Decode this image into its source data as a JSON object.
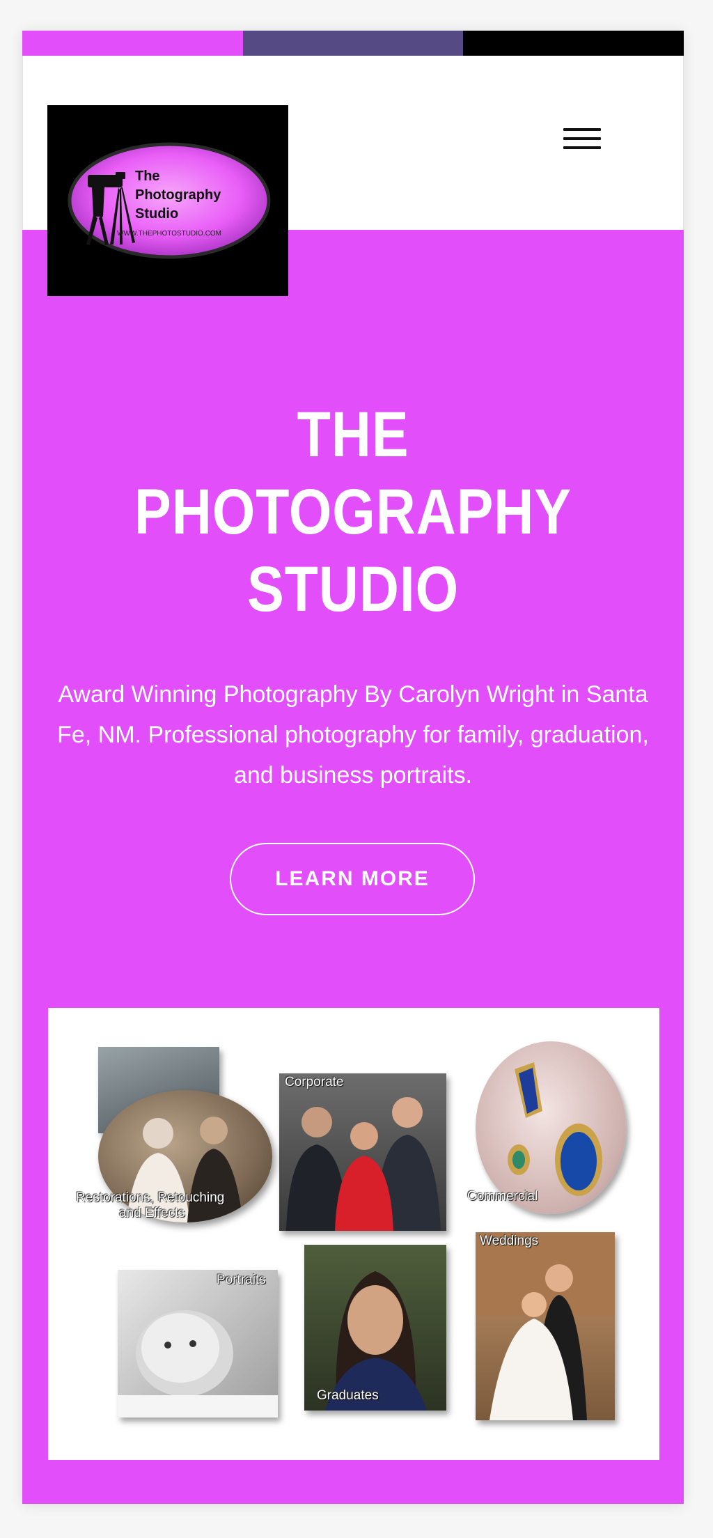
{
  "topbar": {
    "colors": [
      "#e24ffa",
      "#554a84",
      "#000000"
    ]
  },
  "logo": {
    "line1": "The",
    "line2": "Photography",
    "line3": "Studio",
    "url": "WWW.THEPHOTOSTUDIO.COM",
    "ellipse_color": "#e95ef7"
  },
  "header": {
    "menu_icon": "hamburger-menu-icon"
  },
  "hero": {
    "title_line1": "THE",
    "title_line2": "PHOTOGRAPHY",
    "title_line3": "STUDIO",
    "subtitle": "Award Winning Photography By Carolyn Wright in Santa Fe, NM. Professional photography for family, graduation, and business portraits.",
    "button_label": "LEARN MORE",
    "background": "#e24ffa"
  },
  "collage": {
    "restorations": "Restorations, Retouching",
    "restorations2": "and Effects",
    "corporate": "Corporate",
    "commercial": "Commercial",
    "portraits": "Portraits",
    "graduates": "Graduates",
    "weddings": "Weddings"
  }
}
